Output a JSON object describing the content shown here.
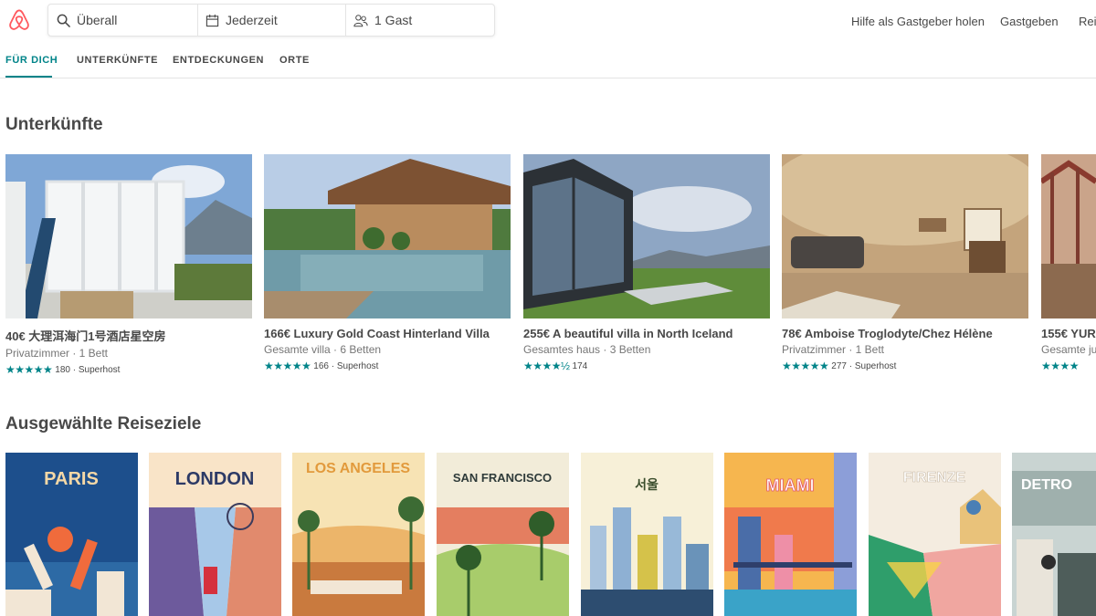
{
  "header": {
    "search": {
      "location": "Überall",
      "date": "Jederzeit",
      "guests": "1 Gast"
    },
    "links": [
      "Hilfe als Gastgeber holen",
      "Gastgeben",
      "Rei"
    ]
  },
  "tabs": [
    "FÜR DICH",
    "UNTERKÜNFTE",
    "ENTDECKUNGEN",
    "ORTE"
  ],
  "section_stays": {
    "title": "Unterkünfte"
  },
  "listings": [
    {
      "title": "40€ 大理洱海门1号酒店星空房",
      "subtitle": "Privatzimmer · 1 Bett",
      "stars": "★★★★★",
      "reviews": "180 · Superhost"
    },
    {
      "title": "166€ Luxury Gold Coast Hinterland Villa",
      "subtitle": "Gesamte villa · 6 Betten",
      "stars": "★★★★★",
      "reviews": "166 · Superhost"
    },
    {
      "title": "255€ A beautiful villa in North Iceland",
      "subtitle": "Gesamtes haus · 3 Betten",
      "stars": "★★★★½",
      "reviews": "174"
    },
    {
      "title": "78€ Amboise Troglodyte/Chez Hélène",
      "subtitle": "Privatzimmer · 1 Bett",
      "stars": "★★★★★",
      "reviews": "277 · Superhost"
    },
    {
      "title": "155€ YUR",
      "subtitle": "Gesamte ju",
      "stars": "★★★★",
      "reviews": ""
    }
  ],
  "section_destinations": {
    "title": "Ausgewählte Reiseziele"
  },
  "destinations": [
    {
      "city": "PARIS"
    },
    {
      "city": "LONDON"
    },
    {
      "city": "LOS ANGELES"
    },
    {
      "city": "SAN FRANCISCO"
    },
    {
      "city": "서울"
    },
    {
      "city": "MIAMI"
    },
    {
      "city": "FIRENZE"
    },
    {
      "city": "DETRO"
    }
  ],
  "colors": {
    "brand": "#ff5a5f",
    "accent": "#008489",
    "text": "#484848",
    "muted": "#767676"
  }
}
